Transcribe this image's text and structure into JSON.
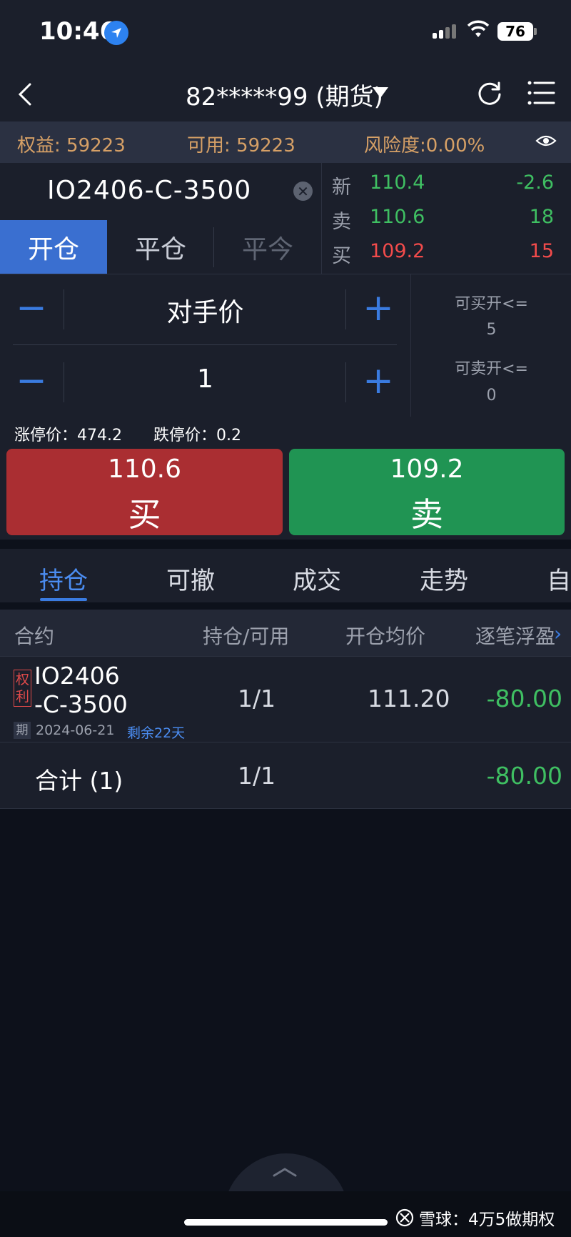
{
  "status_bar": {
    "time": "10:46",
    "battery": "76"
  },
  "nav": {
    "account": "82*****99 (期货)"
  },
  "account_bar": {
    "equity": "权益: 59223",
    "available": "可用: 59223",
    "risk": "风险度:0.00%"
  },
  "contract": {
    "code": "IO2406-C-3500"
  },
  "order_tabs": [
    "开仓",
    "平仓",
    "平今"
  ],
  "quote": {
    "latest": {
      "label": "新",
      "price": "110.4",
      "change": "-2.6"
    },
    "ask": {
      "label": "卖",
      "price": "110.6",
      "volume": "18"
    },
    "bid": {
      "label": "买",
      "price": "109.2",
      "volume": "15"
    }
  },
  "order": {
    "price_type": "对手价",
    "quantity": "1",
    "can_buy_open_label": "可买开<=",
    "can_buy_open_value": "5",
    "can_sell_open_label": "可卖开<=",
    "can_sell_open_value": "0"
  },
  "limits": {
    "up": "涨停价：474.2",
    "down": "跌停价：0.2"
  },
  "trade_buttons": {
    "buy_price": "110.6",
    "buy_label": "买",
    "sell_price": "109.2",
    "sell_label": "卖"
  },
  "position_tabs": [
    "持仓",
    "可撤",
    "成交",
    "走势",
    "自"
  ],
  "table": {
    "headers": [
      "合约",
      "持仓/可用",
      "开仓均价",
      "逐笔浮盈"
    ],
    "rows": [
      {
        "badge": "权利",
        "code_line1": "IO2406",
        "code_line2": "-C-3500",
        "type_badge": "期",
        "expiry": "2024-06-21",
        "remaining": "剩余22天",
        "position": "1/1",
        "avg_price": "111.20",
        "pnl": "-80.00"
      }
    ],
    "total": {
      "label": "合计 (1)",
      "position": "1/1",
      "pnl": "-80.00"
    }
  },
  "watermark": "雪球：4万5做期权",
  "colors": {
    "accent": "#3a7be0",
    "buy": "#aa2e32",
    "sell": "#209453",
    "up": "#f24b4b",
    "down": "#3fbf62",
    "account_text": "#d6a066"
  }
}
